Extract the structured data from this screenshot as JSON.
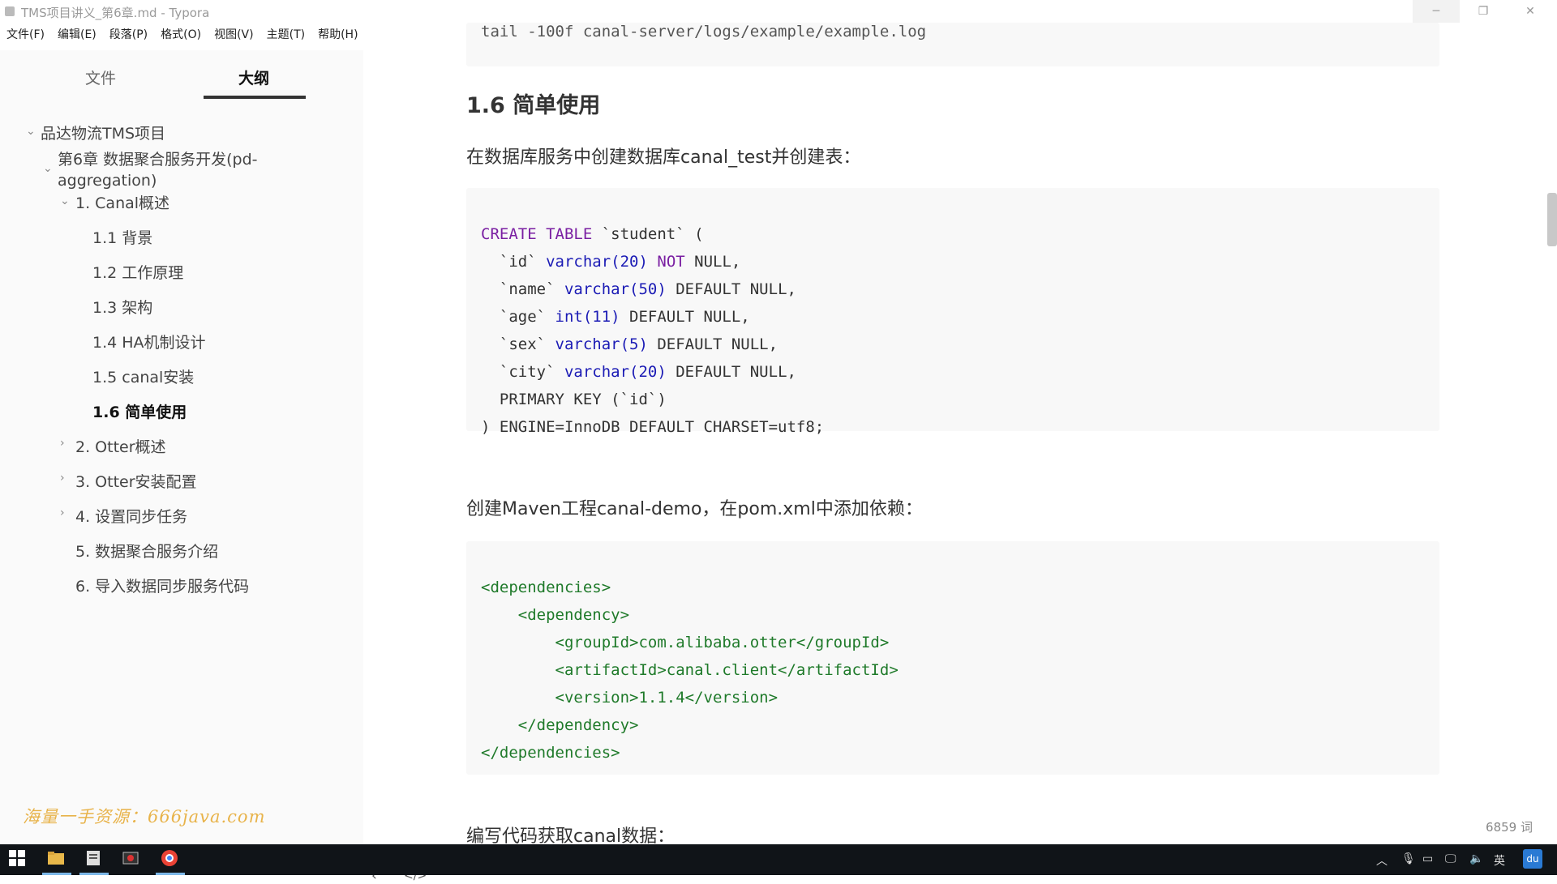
{
  "window": {
    "title": "TMS项目讲义_第6章.md - Typora",
    "controls": {
      "minimize": "─",
      "maximize": "❐",
      "close": "✕"
    }
  },
  "menu": [
    "文件(F)",
    "编辑(E)",
    "段落(P)",
    "格式(O)",
    "视图(V)",
    "主题(T)",
    "帮助(H)"
  ],
  "sidebar": {
    "tabs": {
      "files": "文件",
      "outline": "大纲"
    },
    "outline": [
      {
        "label": "品达物流TMS项目",
        "chevron": "⌄"
      },
      {
        "label": "第6章 数据聚合服务开发(pd-",
        "label2": "aggregation)",
        "chevron": "⌄"
      },
      {
        "label": "1. Canal概述",
        "chevron": "⌄"
      },
      {
        "label": "1.1 背景"
      },
      {
        "label": "1.2 工作原理"
      },
      {
        "label": "1.3 架构"
      },
      {
        "label": "1.4 HA机制设计"
      },
      {
        "label": "1.5 canal安装"
      },
      {
        "label": "1.6 简单使用",
        "active": true
      },
      {
        "label": "2. Otter概述",
        "chevron": "›"
      },
      {
        "label": "3. Otter安装配置",
        "chevron": "›"
      },
      {
        "label": "4. 设置同步任务",
        "chevron": "›"
      },
      {
        "label": "5. 数据聚合服务介绍"
      },
      {
        "label": "6. 导入数据同步服务代码"
      }
    ],
    "watermark": "海量一手资源：666java.com",
    "bottom": {
      "back": "‹",
      "source": "</>"
    }
  },
  "content": {
    "prev_code_line": "tail -100f canal-server/logs/example/example.log",
    "heading": "1.6 简单使用",
    "para1": "在数据库服务中创建数据库canal_test并创建表：",
    "sql": [
      "CREATE TABLE `student` (",
      "  `id` varchar(20) NOT NULL,",
      "  `name` varchar(50) DEFAULT NULL,",
      "  `age` int(11) DEFAULT NULL,",
      "  `sex` varchar(5) DEFAULT NULL,",
      "  `city` varchar(20) DEFAULT NULL,",
      "  PRIMARY KEY (`id`)",
      ") ENGINE=InnoDB DEFAULT CHARSET=utf8;"
    ],
    "para2": "创建Maven工程canal-demo，在pom.xml中添加依赖：",
    "xml": [
      "<dependencies>",
      "    <dependency>",
      "        <groupId>com.alibaba.otter</groupId>",
      "        <artifactId>canal.client</artifactId>",
      "        <version>1.1.4</version>",
      "    </dependency>",
      "</dependencies>"
    ],
    "para3": "编写代码获取canal数据：",
    "word_count": "6859 词"
  },
  "taskbar": {
    "tray": {
      "ime": "英",
      "app": "du"
    }
  },
  "colors": {
    "accent": "#333333",
    "code_bg": "#f8f8f8",
    "watermark": "#e8b34a",
    "keyword": "#7a1fa2",
    "type": "#1b1bb5"
  }
}
